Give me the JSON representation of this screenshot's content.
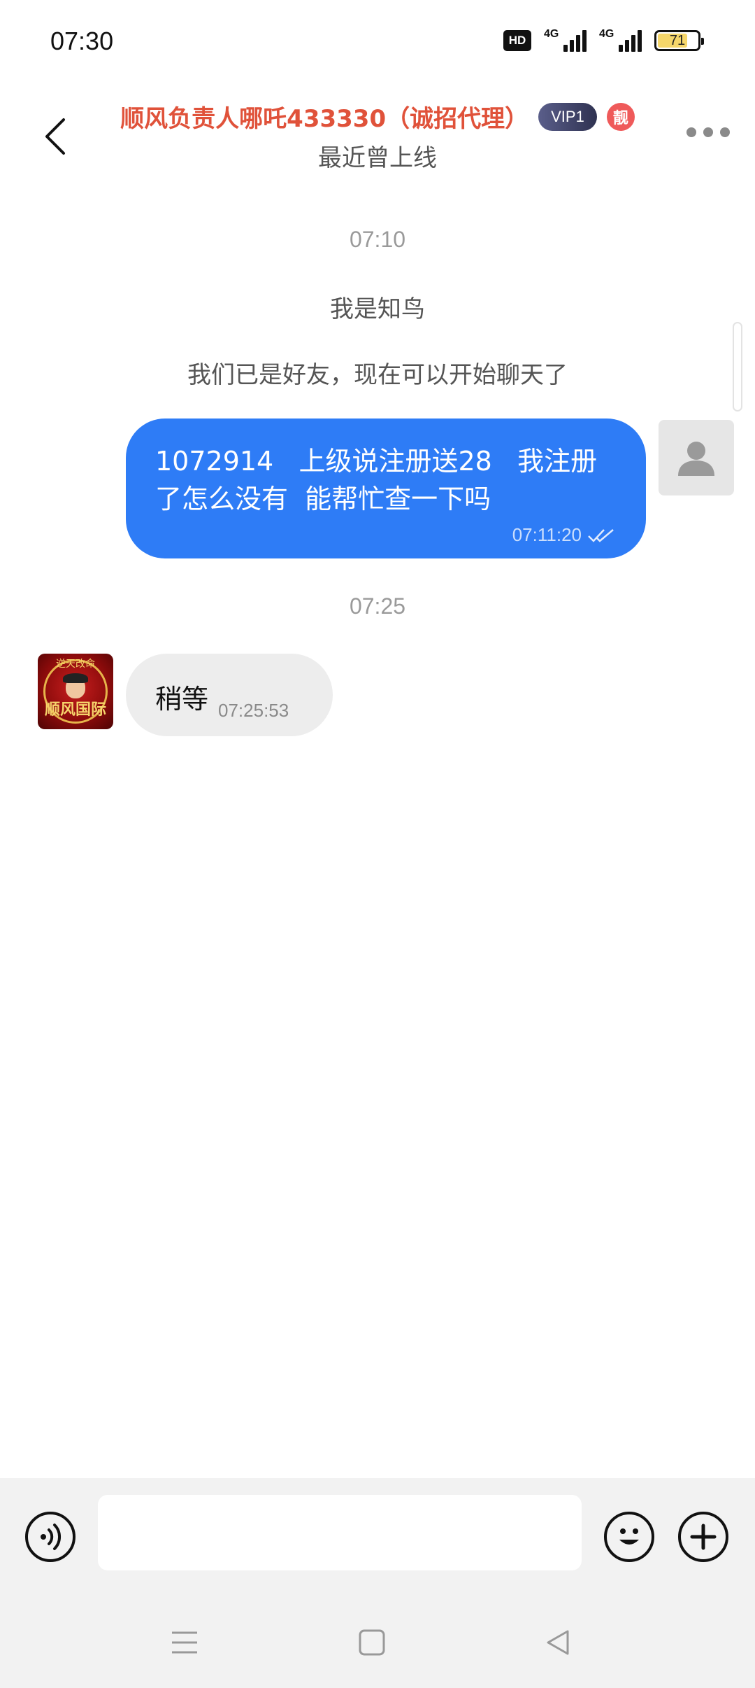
{
  "status_bar": {
    "time": "07:30",
    "hd_label": "HD",
    "network_1": "4G",
    "network_2": "4G",
    "battery_level": "71"
  },
  "header": {
    "title": "顺风负责人哪吒433330（诚招代理）",
    "vip_badge": "VIP1",
    "liang_badge": "靓",
    "subtitle": "最近曾上线"
  },
  "messages": {
    "time_sep_1": "07:10",
    "system_1": "我是知鸟",
    "system_2": "我们已是好友，现在可以开始聊天了",
    "outgoing_1": {
      "line1": "1072914   上级说注册送28   我注册",
      "line2": "了怎么没有  能帮忙查一下吗",
      "time": "07:11:20",
      "read_icon": "double-check-icon"
    },
    "time_sep_2": "07:25",
    "incoming_1": {
      "text": "稍等",
      "time": "07:25:53",
      "avatar_caption": "顺风国际",
      "avatar_top": "逆天改命"
    }
  },
  "input_bar": {
    "placeholder": "",
    "voice_icon": "voice-icon",
    "emoji_icon": "emoji-icon",
    "plus_icon": "plus-icon"
  },
  "nav_bar": {
    "menu_icon": "menu-icon",
    "home_icon": "home-icon",
    "back_icon": "back-triangle-icon"
  },
  "colors": {
    "title": "#e0523a",
    "bubble_out": "#2e7cf6",
    "bubble_in": "#ededed",
    "battery": "#f5d66a"
  }
}
